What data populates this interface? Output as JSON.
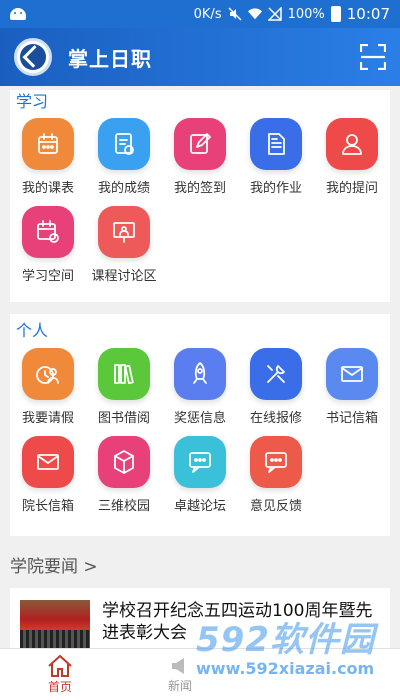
{
  "status_bar": {
    "speed": "0K/s",
    "battery": "100%",
    "time": "10:07"
  },
  "app": {
    "title": "掌上日职"
  },
  "study": {
    "title": "学习",
    "items": [
      {
        "label": "我的课表",
        "icon": "calendar-icon",
        "color": "#f08a3a"
      },
      {
        "label": "我的成绩",
        "icon": "report-icon",
        "color": "#3aa0f0"
      },
      {
        "label": "我的签到",
        "icon": "edit-icon",
        "color": "#e8417a"
      },
      {
        "label": "我的作业",
        "icon": "document-icon",
        "color": "#3a6ee8"
      },
      {
        "label": "我的提问",
        "icon": "user-icon",
        "color": "#ee4a4a"
      },
      {
        "label": "学习空间",
        "icon": "calendar-clock-icon",
        "color": "#e8417a"
      },
      {
        "label": "课程讨论区",
        "icon": "presentation-icon",
        "color": "#ee5a5a"
      }
    ]
  },
  "personal": {
    "title": "个人",
    "items": [
      {
        "label": "我要请假",
        "icon": "leave-icon",
        "color": "#f08a3a"
      },
      {
        "label": "图书借阅",
        "icon": "books-icon",
        "color": "#5ac83a"
      },
      {
        "label": "奖惩信息",
        "icon": "rocket-icon",
        "color": "#5a7ef0"
      },
      {
        "label": "在线报修",
        "icon": "tools-icon",
        "color": "#3a6ee8"
      },
      {
        "label": "书记信箱",
        "icon": "mail-icon",
        "color": "#5a8af0"
      },
      {
        "label": "院长信箱",
        "icon": "mail-icon",
        "color": "#ee4a4a"
      },
      {
        "label": "三维校园",
        "icon": "cube-icon",
        "color": "#e8417a"
      },
      {
        "label": "卓越论坛",
        "icon": "chat-icon",
        "color": "#3ac0d8"
      },
      {
        "label": "意见反馈",
        "icon": "feedback-icon",
        "color": "#ee5a4a"
      }
    ]
  },
  "news": {
    "header": "学院要闻 >",
    "items": [
      {
        "title": "学校召开纪念五四运动100周年暨先进表彰大会"
      }
    ]
  },
  "bottom_nav": {
    "home": "首页",
    "news": "新闻"
  },
  "watermark": {
    "main": "592软件园",
    "url": "www.592xiazai.com"
  }
}
